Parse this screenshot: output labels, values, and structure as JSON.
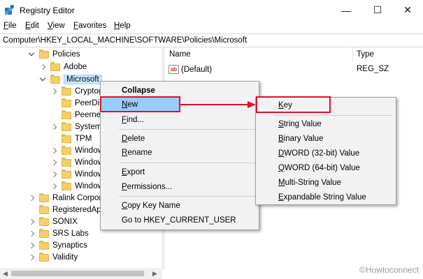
{
  "window": {
    "title": "Registry Editor",
    "minimize_glyph": "—",
    "maximize_glyph": "☐",
    "close_glyph": "✕"
  },
  "menu": [
    {
      "label": "File",
      "accel": "F",
      "rest": "ile"
    },
    {
      "label": "Edit",
      "accel": "E",
      "rest": "dit"
    },
    {
      "label": "View",
      "accel": "V",
      "rest": "iew"
    },
    {
      "label": "Favorites",
      "accel": "F",
      "rest": "avorites"
    },
    {
      "label": "Help",
      "accel": "H",
      "rest": "elp"
    }
  ],
  "address": "Computer\\HKEY_LOCAL_MACHINE\\SOFTWARE\\Policies\\Microsoft",
  "tree": [
    {
      "label": "Policies",
      "expander": "down"
    },
    {
      "label": "Adobe",
      "expander": "right"
    },
    {
      "label": "Microsoft",
      "expander": "down",
      "selected": true
    },
    {
      "label": "Cryptog",
      "expander": "right"
    },
    {
      "label": "PeerDist",
      "expander": "none"
    },
    {
      "label": "Peernet",
      "expander": "none"
    },
    {
      "label": "SystemC",
      "expander": "right"
    },
    {
      "label": "TPM",
      "expander": "none"
    },
    {
      "label": "Window",
      "expander": "right"
    },
    {
      "label": "Window",
      "expander": "right"
    },
    {
      "label": "Window",
      "expander": "right"
    },
    {
      "label": "Window",
      "expander": "right"
    },
    {
      "label": "Ralink Corpor",
      "expander": "right"
    },
    {
      "label": "RegisteredAp",
      "expander": "none"
    },
    {
      "label": "SONIX",
      "expander": "right"
    },
    {
      "label": "SRS Labs",
      "expander": "right"
    },
    {
      "label": "Synaptics",
      "expander": "right"
    },
    {
      "label": "Validity",
      "expander": "right"
    }
  ],
  "values_pane": {
    "columns": {
      "name": "Name",
      "type": "Type"
    },
    "rows": [
      {
        "name": "(Default)",
        "type": "REG_SZ",
        "icon": "ab-icon"
      }
    ]
  },
  "context_menu": {
    "items": [
      {
        "label": "Collapse",
        "bold": true
      },
      {
        "label": "New",
        "accel": "N",
        "rest": "ew",
        "submenu": true,
        "highlighted": true
      },
      {
        "label": "Find...",
        "accel": "F",
        "rest": "ind..."
      },
      {
        "label": "Delete",
        "accel": "D",
        "rest": "elete"
      },
      {
        "label": "Rename",
        "accel": "R",
        "rest": "ename"
      },
      {
        "label": "Export",
        "accel": "E",
        "rest": "xport"
      },
      {
        "label": "Permissions...",
        "accel": "P",
        "rest": "ermissions..."
      },
      {
        "label": "Copy Key Name",
        "accel": "C",
        "rest": "opy Key Name"
      },
      {
        "label": "Go to HKEY_CURRENT_USER",
        "accel": "",
        "rest": "Go to HKEY_CURRENT_USER"
      }
    ]
  },
  "submenu": {
    "items": [
      {
        "label": "Key",
        "accel": "K",
        "rest": "ey"
      },
      {
        "label": "String Value",
        "accel": "S",
        "rest": "tring Value"
      },
      {
        "label": "Binary Value",
        "accel": "B",
        "rest": "inary Value"
      },
      {
        "label": "DWORD (32-bit) Value",
        "accel": "D",
        "rest": "WORD (32-bit) Value"
      },
      {
        "label": "QWORD (64-bit) Value",
        "accel": "Q",
        "rest": "WORD (64-bit) Value"
      },
      {
        "label": "Multi-String Value",
        "accel": "M",
        "rest": "ulti-String Value"
      },
      {
        "label": "Expandable String Value",
        "accel": "E",
        "rest": "xpandable String Value"
      }
    ]
  },
  "watermark": "©Howtoconnect",
  "colors": {
    "highlight": "#99ccff",
    "annotation_red": "#e0102a",
    "folder": "#f5cf6a"
  }
}
